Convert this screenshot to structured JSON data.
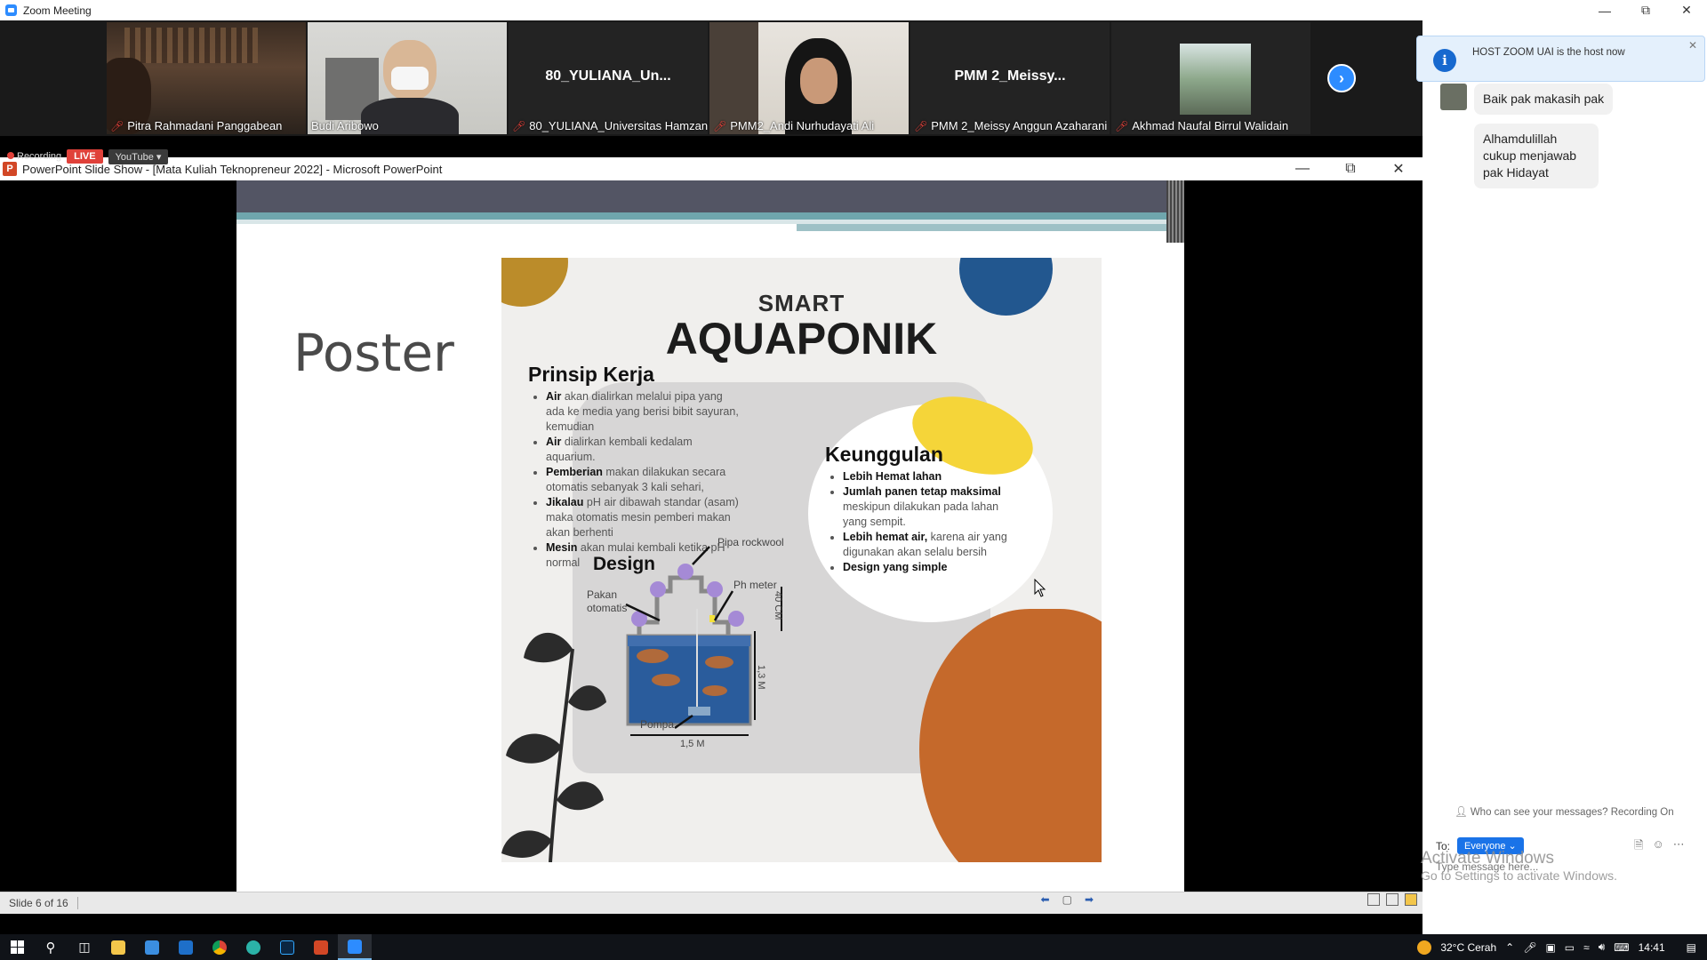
{
  "zoom": {
    "title": "Zoom Meeting"
  },
  "gallery": {
    "participants": [
      {
        "name": "Pitra Rahmadani Panggabean",
        "muted": true,
        "video": true
      },
      {
        "name": "Budi Aribowo",
        "muted": false,
        "video": true,
        "active": true
      },
      {
        "name": "80_YULIANA_Universitas Hamzan...",
        "short": "80_YULIANA_Un...",
        "muted": true,
        "video": false
      },
      {
        "name": "PMM2_Andi Nurhudayati Ali",
        "muted": true,
        "video": true
      },
      {
        "name": "PMM 2_Meissy Anggun Azaharani",
        "short": "PMM 2_Meissy...",
        "muted": true,
        "video": false
      },
      {
        "name": "Akhmad Naufal Birrul Walidain",
        "muted": true,
        "video": true
      }
    ]
  },
  "recording": {
    "label": "Recording",
    "live_label": "LIVE",
    "stream_label": "YouTube"
  },
  "powerpoint": {
    "title": "PowerPoint Slide Show - [Mata Kuliah Teknopreneur 2022] - Microsoft PowerPoint",
    "status": "Slide 6 of 16"
  },
  "slide": {
    "title": "Poster",
    "poster": {
      "smart": "SMART",
      "title": "AQUAPONIK",
      "prinsip": {
        "heading": "Prinsip Kerja",
        "items": [
          {
            "bold": "Air",
            "text": " akan dialirkan melalui pipa yang ada ke media yang berisi bibit sayuran, kemudian"
          },
          {
            "bold": "Air",
            "text": " dialirkan kembali kedalam aquarium."
          },
          {
            "bold": "Pemberian",
            "text": " makan dilakukan secara otomatis sebanyak 3 kali sehari,"
          },
          {
            "bold": "Jikalau",
            "text": " pH air dibawah standar (asam) maka otomatis mesin pemberi makan akan berhenti"
          },
          {
            "bold": "Mesin",
            "text": " akan mulai kembali ketika pH normal"
          }
        ]
      },
      "keunggulan": {
        "heading": "Keunggulan",
        "items": [
          {
            "bold": "Lebih Hemat lahan",
            "text": ""
          },
          {
            "bold": "Jumlah panen tetap maksimal",
            "text": " meskipun dilakukan pada lahan yang sempit."
          },
          {
            "bold": "Lebih hemat air,",
            "text": " karena air yang digunakan akan selalu bersih"
          },
          {
            "bold": "Design yang simple",
            "text": ""
          }
        ]
      },
      "design": {
        "heading": "Design",
        "labels": {
          "pipa": "Pipa rockwool",
          "ph": "Ph meter",
          "pakan": "Pakan otomatis",
          "pompa": "Pompa",
          "height1": "40 CM",
          "height2": "1,3 M",
          "width": "1,5 M"
        }
      }
    }
  },
  "chat": {
    "host_notice": "HOST ZOOM UAI is the host now",
    "messages": [
      {
        "text": "Baik pak makasih pak"
      },
      {
        "text": "Alhamdulillah cukup menjawab pak Hidayat"
      }
    ],
    "who_can_see": "Who can see your messages? Recording On",
    "to_label": "To:",
    "recipient": "Everyone",
    "placeholder": "Type message here..."
  },
  "watermark": {
    "line1": "Activate Windows",
    "line2": "Go to Settings to activate Windows."
  },
  "taskbar": {
    "weather": "32°C  Cerah",
    "time": "14:41"
  },
  "colors": {
    "zoom_blue": "#2d8cff",
    "live_red": "#e0413a",
    "ppt_orange": "#d24726",
    "poster_blue": "#22578f",
    "poster_orange": "#c5692b",
    "poster_yellow": "#f5d539"
  }
}
